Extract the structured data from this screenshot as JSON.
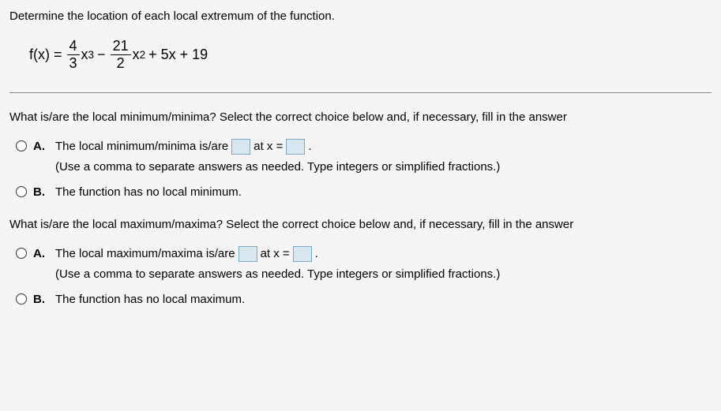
{
  "prompt": "Determine the location of each local extremum of the function.",
  "formula": {
    "lhs": "f(x) =",
    "frac1_num": "4",
    "frac1_den": "3",
    "term1_var": "x",
    "term1_exp": "3",
    "op1": "−",
    "frac2_num": "21",
    "frac2_den": "2",
    "term2_var": "x",
    "term2_exp": "2",
    "rest": "+ 5x + 19"
  },
  "q1": {
    "text": "What is/are the local minimum/minima? Select the correct choice below and, if necessary, fill in the answer",
    "a": {
      "label": "A.",
      "part1": "The local minimum/minima is/are",
      "part2": "at x =",
      "part3": ".",
      "hint": "(Use a comma to separate answers as needed. Type integers or simplified fractions.)"
    },
    "b": {
      "label": "B.",
      "text": "The function has no local minimum."
    }
  },
  "q2": {
    "text": "What is/are the local maximum/maxima? Select the correct choice below and, if necessary, fill in the answer",
    "a": {
      "label": "A.",
      "part1": "The local maximum/maxima is/are",
      "part2": "at x =",
      "part3": ".",
      "hint": "(Use a comma to separate answers as needed. Type integers or simplified fractions.)"
    },
    "b": {
      "label": "B.",
      "text": "The function has no local maximum."
    }
  }
}
